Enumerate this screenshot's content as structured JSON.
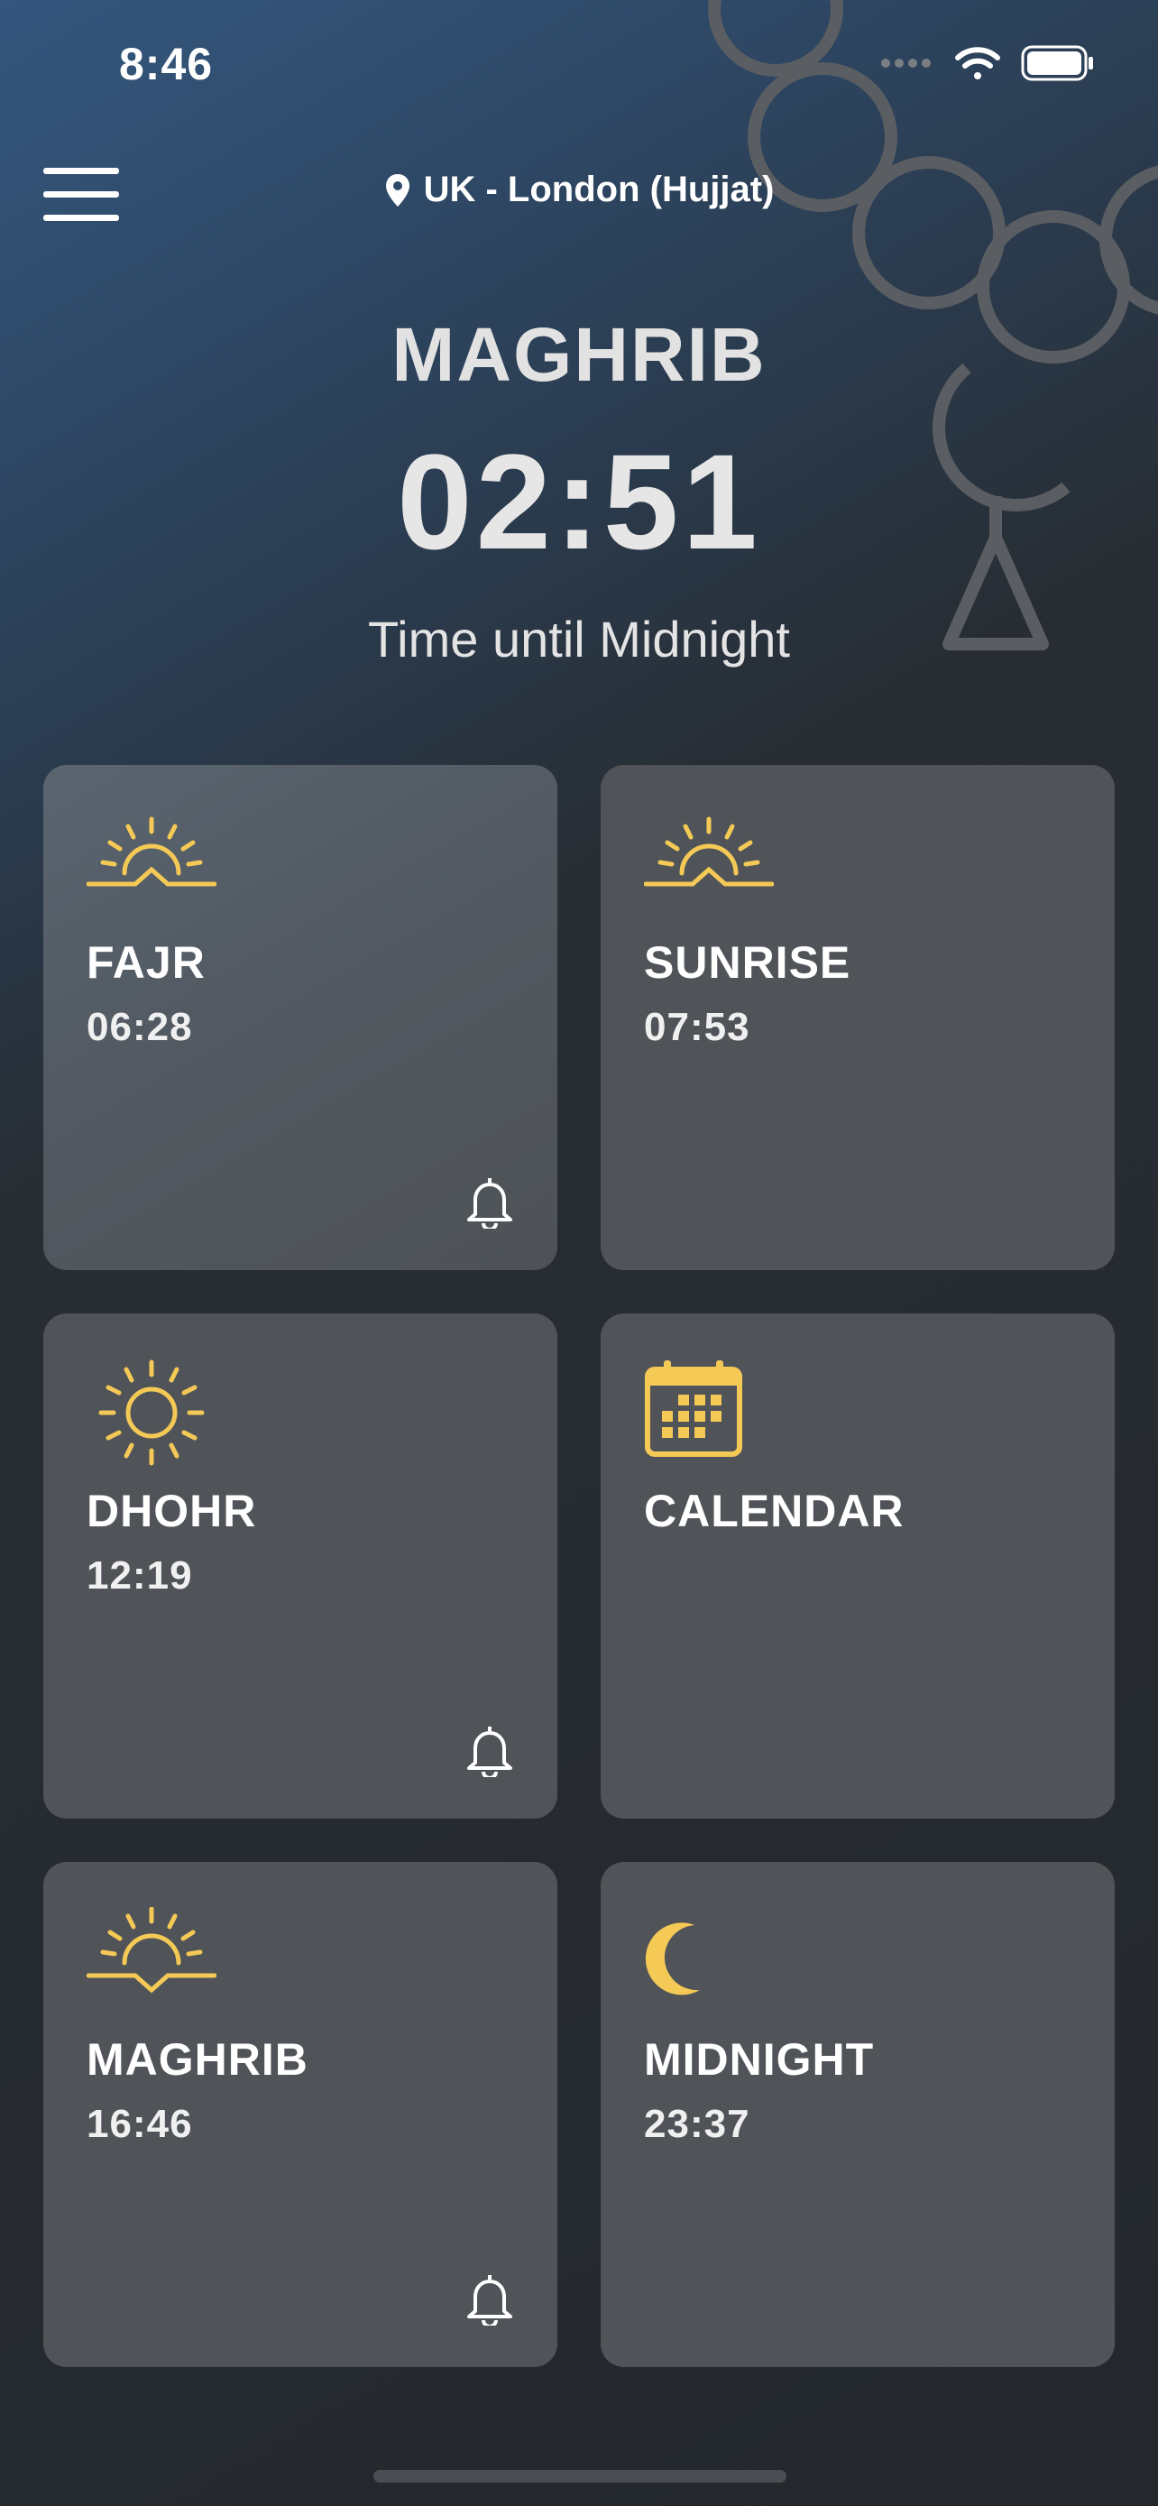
{
  "status_bar": {
    "time": "8:46"
  },
  "header": {
    "location": "UK - London (Hujjat)"
  },
  "current": {
    "prayer": "MAGHRIB",
    "countdown": "02:51",
    "label": "Time until Midnight"
  },
  "cards": [
    {
      "title": "FAJR",
      "time": "06:28",
      "icon": "sunrise-icon",
      "alarm": true
    },
    {
      "title": "SUNRISE",
      "time": "07:53",
      "icon": "sunrise-icon",
      "alarm": false
    },
    {
      "title": "DHOHR",
      "time": "12:19",
      "icon": "sun-icon",
      "alarm": true
    },
    {
      "title": "CALENDAR",
      "time": "",
      "icon": "calendar-icon",
      "alarm": false
    },
    {
      "title": "MAGHRIB",
      "time": "16:46",
      "icon": "sunset-icon",
      "alarm": true
    },
    {
      "title": "MIDNIGHT",
      "time": "23:37",
      "icon": "moon-icon",
      "alarm": false
    }
  ],
  "colors": {
    "accent": "#f5c956",
    "card": "#505458",
    "background": "#24282c"
  }
}
